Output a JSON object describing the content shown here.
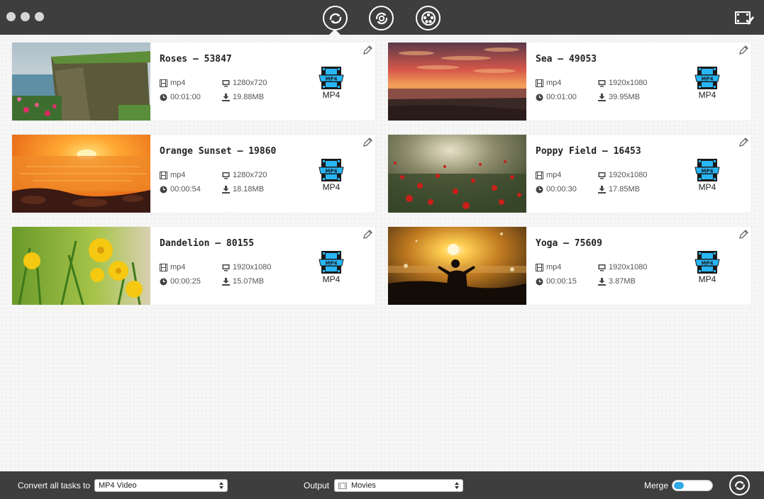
{
  "toolbar": {
    "tools": [
      {
        "icon": "convert-icon",
        "active": true
      },
      {
        "icon": "dvd-convert-icon",
        "active": false
      },
      {
        "icon": "film-reel-icon",
        "active": false
      }
    ],
    "right_icon": "video-editor-icon"
  },
  "tasks": [
    {
      "title": "Roses – 53847",
      "format": "mp4",
      "resolution": "1280x720",
      "duration": "00:01:00",
      "size": "19.88MB",
      "output_format": "MP4"
    },
    {
      "title": "Sea – 49053",
      "format": "mp4",
      "resolution": "1920x1080",
      "duration": "00:01:00",
      "size": "39.95MB",
      "output_format": "MP4"
    },
    {
      "title": "Orange Sunset – 19860",
      "format": "mp4",
      "resolution": "1280x720",
      "duration": "00:00:54",
      "size": "18.18MB",
      "output_format": "MP4"
    },
    {
      "title": "Poppy Field – 16453",
      "format": "mp4",
      "resolution": "1920x1080",
      "duration": "00:00:30",
      "size": "17.85MB",
      "output_format": "MP4"
    },
    {
      "title": "Dandelion – 80155",
      "format": "mp4",
      "resolution": "1920x1080",
      "duration": "00:00:25",
      "size": "15.07MB",
      "output_format": "MP4"
    },
    {
      "title": "Yoga – 75609",
      "format": "mp4",
      "resolution": "1920x1080",
      "duration": "00:00:15",
      "size": "3.87MB",
      "output_format": "MP4"
    }
  ],
  "badge_text": "MP4",
  "bottom": {
    "convert_all_label": "Convert all tasks to",
    "convert_all_value": "MP4 Video",
    "output_label": "Output",
    "output_value": "Movies",
    "merge_label": "Merge",
    "merge_on": false
  },
  "colors": {
    "bar": "#3e3e3e",
    "accent": "#2fa8e6",
    "badge_blue": "#29b6f6"
  }
}
